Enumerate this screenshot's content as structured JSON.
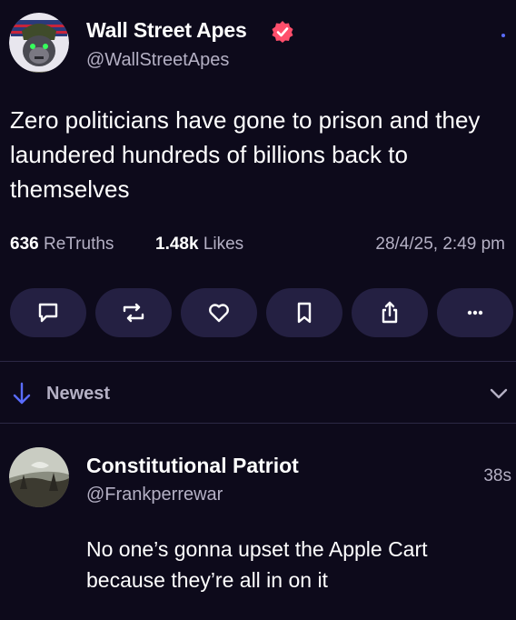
{
  "post": {
    "author_name": "Wall Street Apes",
    "author_handle": "@WallStreetApes",
    "verified_color": "#ff4e6b",
    "text": "Zero politicians have gone to prison and they laundered hundreds of billions back to themselves",
    "stats": {
      "retruths_count": "636",
      "retruths_label": "ReTruths",
      "likes_count": "1.48k",
      "likes_label": "Likes",
      "timestamp": "28/4/25, 2:49 pm"
    },
    "actions": [
      {
        "icon": "reply-icon"
      },
      {
        "icon": "retruth-icon"
      },
      {
        "icon": "heart-icon"
      },
      {
        "icon": "bookmark-icon"
      },
      {
        "icon": "share-icon"
      },
      {
        "icon": "more-icon"
      }
    ]
  },
  "replies_sort": {
    "label": "Newest",
    "icon": "arrow-down-icon"
  },
  "reply": {
    "author_name": "Constitutional Patriot",
    "author_handle": "@Frankperrewar",
    "time": "38s",
    "text": "No one’s gonna upset the Apple Cart because they’re all in on it"
  },
  "colors": {
    "background": "#0d0a1b",
    "button_bg": "#242042",
    "muted_text": "#b4b0c4",
    "accent_blue": "#5a6cff"
  }
}
